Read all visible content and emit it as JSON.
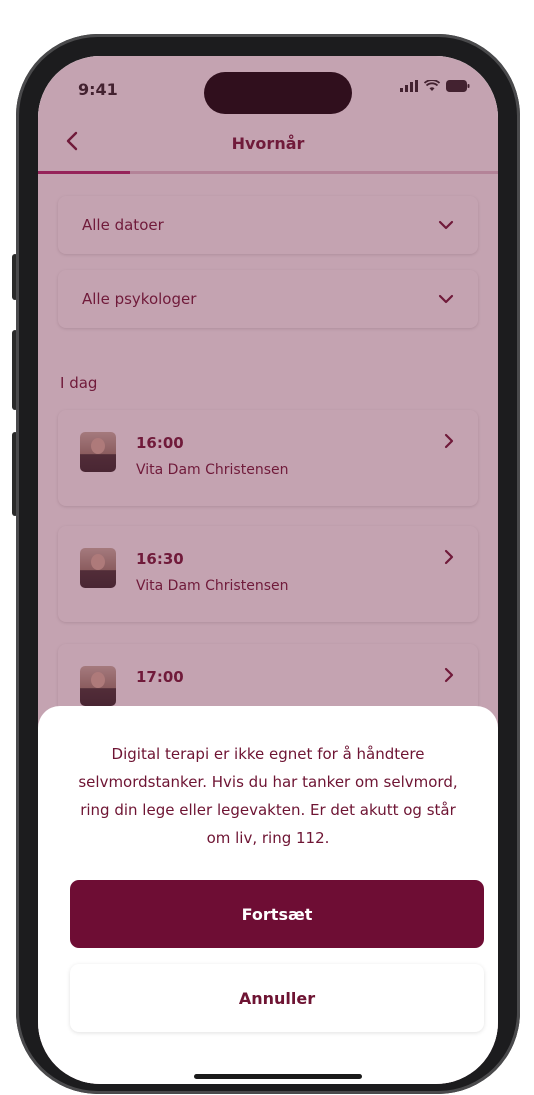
{
  "status_bar": {
    "time": "9:41"
  },
  "nav": {
    "title": "Hvornår",
    "progress": 0.2
  },
  "filters": [
    {
      "label": "Alle datoer"
    },
    {
      "label": "Alle psykologer"
    }
  ],
  "section": {
    "label": "I dag"
  },
  "slots": [
    {
      "time": "16:00",
      "name": "Vita Dam Christensen"
    },
    {
      "time": "16:30",
      "name": "Vita Dam Christensen"
    },
    {
      "time": "17:00",
      "name": ""
    }
  ],
  "sheet": {
    "message": "Digital terapi er ikke egnet for å håndtere selvmordstanker. Hvis du har tanker om selvmord, ring din lege eller legevakten. Er det akutt og står om liv, ring 112.",
    "continue_label": "Fortsæt",
    "cancel_label": "Annuller"
  },
  "colors": {
    "brand": "#6e0d34",
    "text": "#6e1433",
    "overlay": "rgba(115,35,70,0.42)"
  },
  "icons": {
    "back": "chevron-left-icon",
    "dropdown": "chevron-down-icon",
    "row": "chevron-right-icon"
  }
}
